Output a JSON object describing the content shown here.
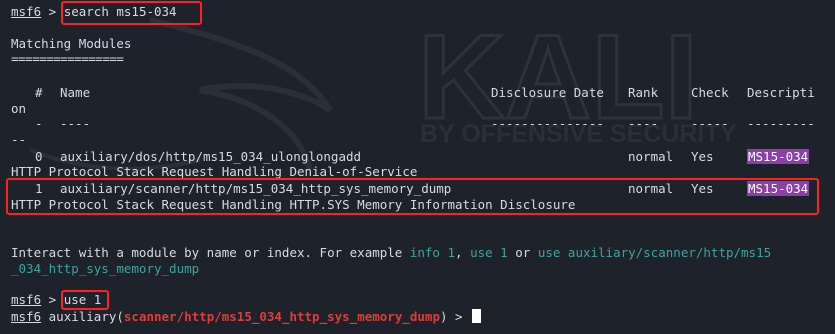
{
  "watermark": {
    "brand": "KALI",
    "tagline": "BY OFFENSIVE SECURITY"
  },
  "prompt": "msf6",
  "cmd1": "search ms15-034",
  "section_title": "Matching Modules",
  "section_underline": "================",
  "headers": {
    "num": "#",
    "name": "Name",
    "date": "Disclosure Date",
    "rank": "Rank",
    "check": "Check",
    "desc": "Descripti",
    "desc_wrap": "on"
  },
  "header_rules": {
    "num": "-",
    "name": "----",
    "date": "---------------",
    "rank": "----",
    "check": "-----",
    "desc": "---------",
    "desc_wrap": "--"
  },
  "rows": [
    {
      "index": "0",
      "name": "auxiliary/dos/http/ms15_034_ulonglongadd",
      "date": "",
      "rank": "normal",
      "check": "Yes",
      "desc_match": "MS15-034",
      "desc_wrap": "HTTP Protocol Stack Request Handling Denial-of-Service"
    },
    {
      "index": "1",
      "name": "auxiliary/scanner/http/ms15_034_http_sys_memory_dump",
      "date": "",
      "rank": "normal",
      "check": "Yes",
      "desc_match": "MS15-034",
      "desc_wrap": "HTTP Protocol Stack Request Handling HTTP.SYS Memory Information Disclosure"
    }
  ],
  "interact": {
    "prefix": "Interact with a module by name or index. For example ",
    "ex1": "info 1",
    "sep1": ", ",
    "ex2": "use 1",
    "sep2": " or ",
    "ex3_a": "use auxiliary/scanner/http/ms15",
    "ex3_b": "_034_http_sys_memory_dump"
  },
  "cmd2": "use 1",
  "prompt2": {
    "module_prefix": "auxiliary(",
    "module": "scanner/http/ms15_034_http_sys_memory_dump",
    "module_suffix": ") > "
  },
  "colors": {
    "background": "#1e222b",
    "highlight_box": "#ff2020",
    "match_bg": "#8b3fa7",
    "module_red": "#e23b3b",
    "link_teal": "#3aa5a0"
  }
}
